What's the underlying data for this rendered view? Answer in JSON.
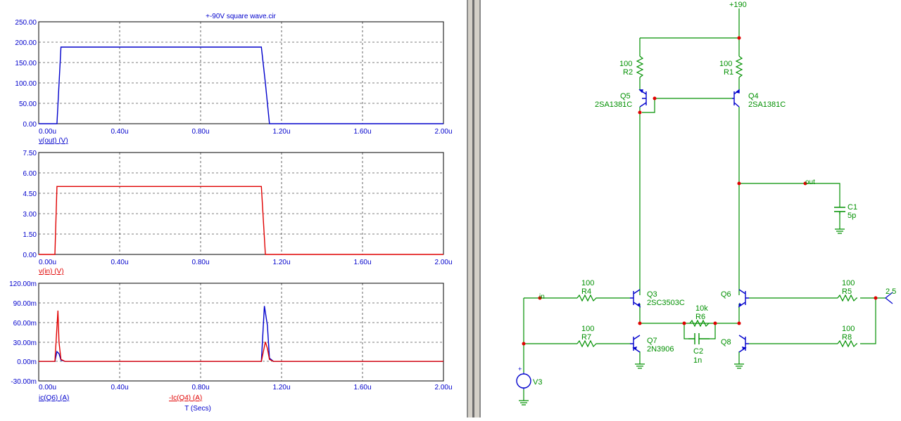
{
  "plot": {
    "title": "+-90V square wave.cir",
    "x_ticks": [
      "0.00u",
      "0.40u",
      "0.80u",
      "1.20u",
      "1.60u",
      "2.00u"
    ],
    "x_axis_label": "T (Secs)",
    "panels": [
      {
        "y_ticks": [
          "250.00",
          "200.00",
          "150.00",
          "100.00",
          "50.00",
          "0.00"
        ],
        "legend": [
          "v(out) (V)"
        ]
      },
      {
        "y_ticks": [
          "7.50",
          "6.00",
          "4.50",
          "3.00",
          "1.50",
          "0.00"
        ],
        "legend": [
          "v(in) (V)"
        ]
      },
      {
        "y_ticks": [
          "120.00m",
          "90.00m",
          "60.00m",
          "30.00m",
          "0.00m",
          "-30.00m"
        ],
        "legend": [
          "ic(Q6) (A)",
          "-Ic(Q4) (A)"
        ]
      }
    ]
  },
  "colors": {
    "trace_blue": "#0000cc",
    "trace_red": "#e00000",
    "wire": "#009000",
    "node": "#e00000",
    "part": "#0000cc",
    "label": "#009000"
  },
  "chart_data": [
    {
      "type": "line",
      "title": "+-90V square wave.cir",
      "xlabel": "",
      "ylabel": "",
      "xlim": [
        0,
        2.0
      ],
      "ylim": [
        0,
        250
      ],
      "series": [
        {
          "name": "v(out) (V)",
          "x": [
            0,
            0.09,
            0.11,
            0.35,
            1.1,
            1.12,
            1.14,
            2.0
          ],
          "y": [
            0,
            0,
            188,
            188,
            188,
            100,
            0,
            0
          ]
        }
      ]
    },
    {
      "type": "line",
      "xlabel": "",
      "ylabel": "",
      "xlim": [
        0,
        2.0
      ],
      "ylim": [
        0,
        7.5
      ],
      "series": [
        {
          "name": "v(in) (V)",
          "x": [
            0,
            0.08,
            0.09,
            1.1,
            1.12,
            2.0
          ],
          "y": [
            0,
            0,
            5,
            5,
            0,
            0
          ]
        }
      ]
    },
    {
      "type": "line",
      "xlabel": "T (Secs)",
      "ylabel": "",
      "xlim": [
        0,
        2.0
      ],
      "ylim": [
        -30,
        120
      ],
      "series": [
        {
          "name": "ic(Q6) (A)",
          "x": [
            0,
            0.08,
            0.09,
            0.1,
            0.11,
            0.13,
            1.1,
            1.115,
            1.13,
            1.14,
            1.16,
            2.0
          ],
          "y": [
            0,
            0,
            15,
            12,
            2,
            0,
            0,
            85,
            55,
            5,
            0,
            0
          ]
        },
        {
          "name": "-Ic(Q4) (A)",
          "x": [
            0,
            0.08,
            0.095,
            0.1,
            0.11,
            0.13,
            1.1,
            1.12,
            1.13,
            1.14,
            1.16,
            2.0
          ],
          "y": [
            0,
            0,
            78,
            30,
            3,
            0,
            0,
            30,
            20,
            3,
            0,
            0
          ]
        }
      ]
    }
  ],
  "schematic": {
    "labels": {
      "vplus": "+190",
      "r2_val": "100",
      "r2": "R2",
      "r1_val": "100",
      "r1": "R1",
      "q5": "Q5",
      "q5_type": "2SA1381C",
      "q4": "Q4",
      "q4_type": "2SA1381C",
      "out": "out",
      "c1": "C1",
      "c1_val": "5p",
      "in": "in",
      "r4_val": "100",
      "r4": "R4",
      "q3": "Q3",
      "q3_type": "2SC3503C",
      "q6": "Q6",
      "r5_val": "100",
      "r5": "R5",
      "vin2": "2.5",
      "r6_val": "10k",
      "r6": "R6",
      "c2": "C2",
      "c2_val": "1n",
      "r7_val": "100",
      "r7": "R7",
      "q7": "Q7",
      "q7_type": "2N3906",
      "q8": "Q8",
      "r8_val": "100",
      "r8": "R8",
      "v3": "V3"
    }
  }
}
